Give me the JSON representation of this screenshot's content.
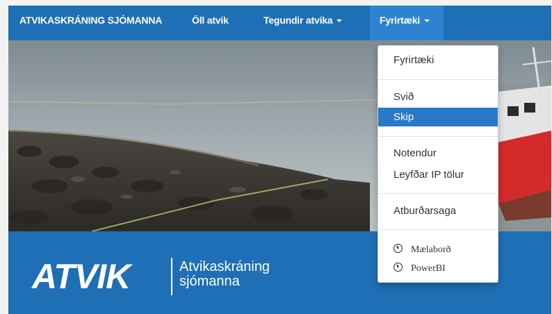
{
  "navbar": {
    "brand": "ATVIKASKRÁNING SJÓMANNA",
    "all_incidents": "Öll atvik",
    "incident_types": "Tegundir atvika",
    "companies": "Fyrirtæki"
  },
  "dropdown": {
    "items": [
      {
        "label": "Fyrirtæki"
      },
      {
        "label": "Svið"
      },
      {
        "label": "Skip",
        "active": true
      },
      {
        "label": "Notendur"
      },
      {
        "label": "Leyfðar IP tölur"
      },
      {
        "label": "Atburðarsaga"
      },
      {
        "label": "Mælaborð",
        "icon": "clock-icon"
      },
      {
        "label": "PowerBI",
        "icon": "clock-icon"
      }
    ]
  },
  "banner": {
    "logo": "ATVIK",
    "subtitle_line1": "Atvikaskráning",
    "subtitle_line2": "sjómanna"
  },
  "colors": {
    "primary": "#1e6fb5",
    "active_nav": "#2d83d1",
    "active_item": "#2a79c9"
  }
}
